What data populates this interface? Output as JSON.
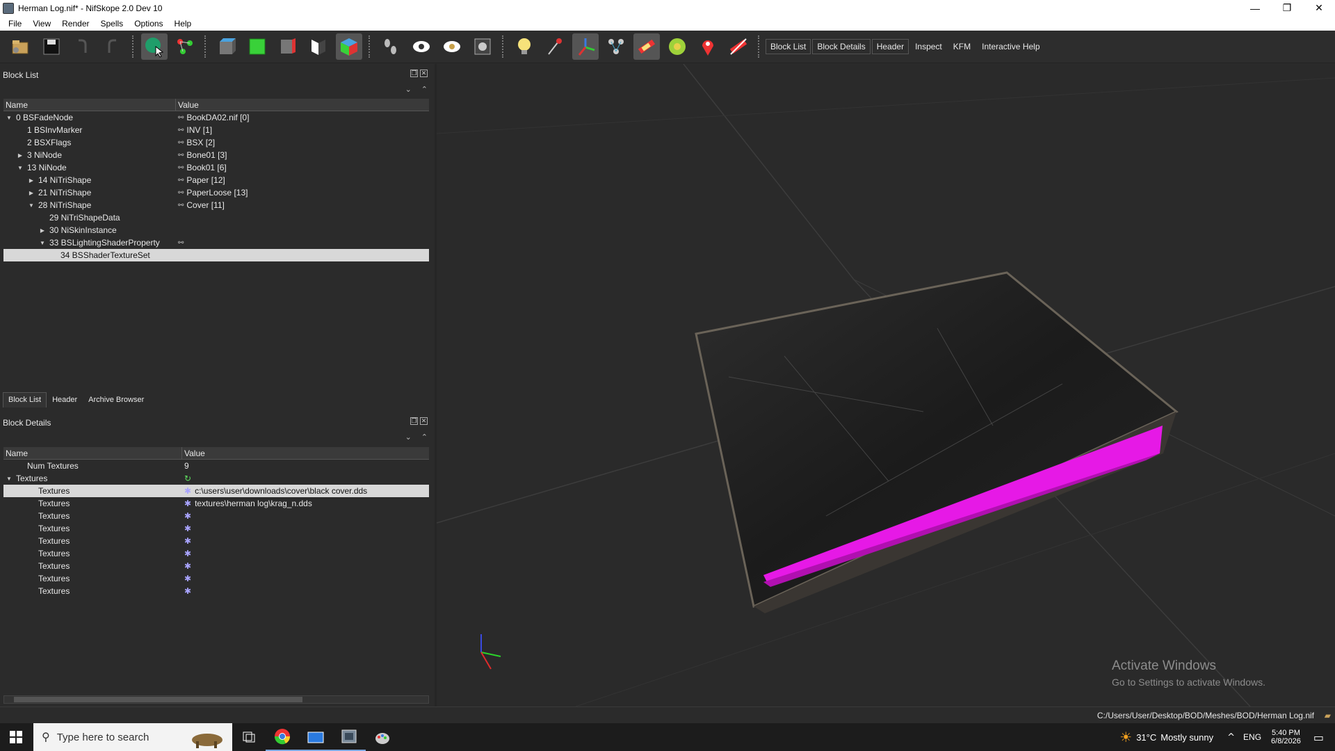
{
  "window": {
    "title": "Herman Log.nif* - NifSkope 2.0 Dev 10",
    "minimize": "—",
    "restore": "❐",
    "close": "✕"
  },
  "menu": [
    "File",
    "View",
    "Render",
    "Spells",
    "Options",
    "Help"
  ],
  "toolbar": {
    "links": [
      "Block List",
      "Block Details",
      "Header",
      "Inspect",
      "KFM",
      "Interactive Help"
    ]
  },
  "block_list": {
    "title": "Block List",
    "col_name": "Name",
    "col_value": "Value",
    "rows": [
      {
        "name": "0 BSFadeNode",
        "value": "BookDA02.nif [0]",
        "depth": 0,
        "arrow": "open",
        "link": true
      },
      {
        "name": "1 BSInvMarker",
        "value": "INV [1]",
        "depth": 1,
        "arrow": "none",
        "link": true
      },
      {
        "name": "2 BSXFlags",
        "value": "BSX [2]",
        "depth": 1,
        "arrow": "none",
        "link": true
      },
      {
        "name": "3 NiNode",
        "value": "Bone01 [3]",
        "depth": 1,
        "arrow": "closed",
        "link": true
      },
      {
        "name": "13 NiNode",
        "value": "Book01 [6]",
        "depth": 1,
        "arrow": "open",
        "link": true
      },
      {
        "name": "14 NiTriShape",
        "value": "Paper [12]",
        "depth": 2,
        "arrow": "closed",
        "link": true
      },
      {
        "name": "21 NiTriShape",
        "value": "PaperLoose [13]",
        "depth": 2,
        "arrow": "closed",
        "link": true
      },
      {
        "name": "28 NiTriShape",
        "value": "Cover [11]",
        "depth": 2,
        "arrow": "open",
        "link": true
      },
      {
        "name": "29 NiTriShapeData",
        "value": "",
        "depth": 3,
        "arrow": "none",
        "link": false
      },
      {
        "name": "30 NiSkinInstance",
        "value": "",
        "depth": 3,
        "arrow": "closed",
        "link": false
      },
      {
        "name": "33 BSLightingShaderProperty",
        "value": "",
        "depth": 3,
        "arrow": "open",
        "link": true
      },
      {
        "name": "34 BSShaderTextureSet",
        "value": "",
        "depth": 4,
        "arrow": "none",
        "link": false,
        "selected": true
      }
    ]
  },
  "tabs": [
    "Block List",
    "Header",
    "Archive Browser"
  ],
  "block_details": {
    "title": "Block Details",
    "col_name": "Name",
    "col_value": "Value",
    "rows": [
      {
        "name": "Num Textures",
        "value": "9",
        "depth": 1,
        "arrow": "none",
        "icon": ""
      },
      {
        "name": "Textures",
        "value": "",
        "depth": 0,
        "arrow": "open",
        "icon": "refresh"
      },
      {
        "name": "Textures",
        "value": "c:\\users\\user\\downloads\\cover\\black cover.dds",
        "depth": 2,
        "arrow": "none",
        "icon": "gear",
        "selected": true
      },
      {
        "name": "Textures",
        "value": "textures\\herman log\\krag_n.dds",
        "depth": 2,
        "arrow": "none",
        "icon": "gear"
      },
      {
        "name": "Textures",
        "value": "",
        "depth": 2,
        "arrow": "none",
        "icon": "gear"
      },
      {
        "name": "Textures",
        "value": "",
        "depth": 2,
        "arrow": "none",
        "icon": "gear"
      },
      {
        "name": "Textures",
        "value": "",
        "depth": 2,
        "arrow": "none",
        "icon": "gear"
      },
      {
        "name": "Textures",
        "value": "",
        "depth": 2,
        "arrow": "none",
        "icon": "gear"
      },
      {
        "name": "Textures",
        "value": "",
        "depth": 2,
        "arrow": "none",
        "icon": "gear"
      },
      {
        "name": "Textures",
        "value": "",
        "depth": 2,
        "arrow": "none",
        "icon": "gear"
      },
      {
        "name": "Textures",
        "value": "",
        "depth": 2,
        "arrow": "none",
        "icon": "gear"
      }
    ]
  },
  "viewport": {
    "watermark_title": "Activate Windows",
    "watermark_sub": "Go to Settings to activate Windows."
  },
  "status": {
    "path": "C:/Users/User/Desktop/BOD/Meshes/BOD/Herman Log.nif"
  },
  "taskbar": {
    "search_placeholder": "Type here to search",
    "temperature": "31°C",
    "weather": "Mostly sunny",
    "language": "ENG",
    "time": "5:40 PM",
    "date": "6/8/2026"
  }
}
